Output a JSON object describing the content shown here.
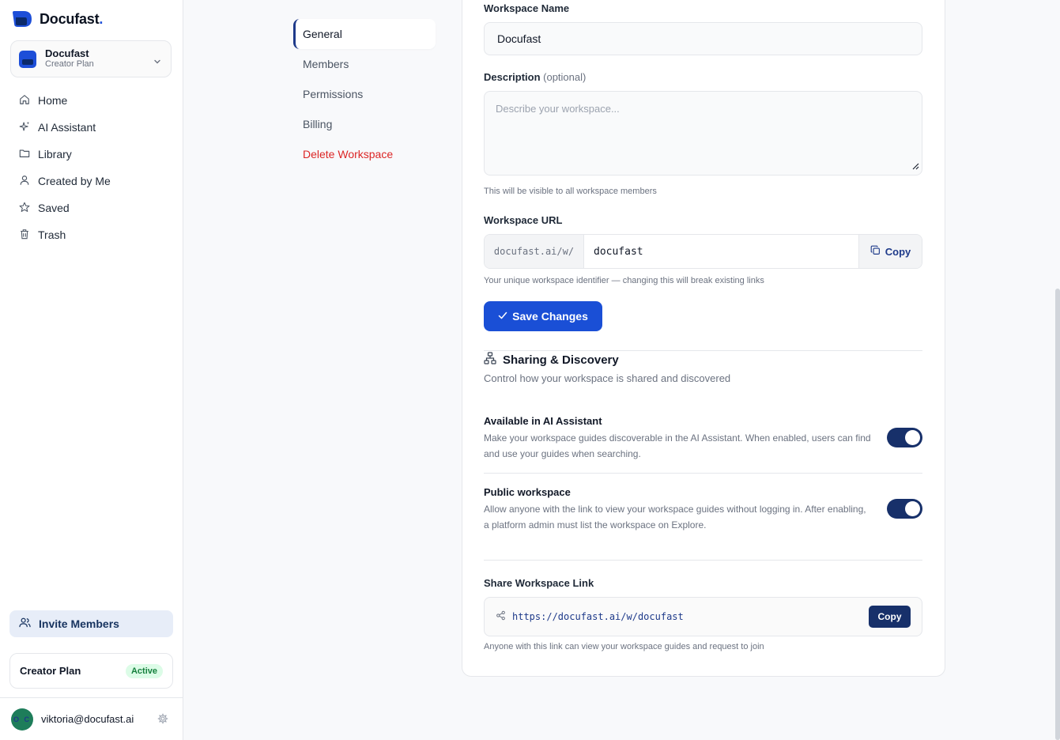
{
  "brand": {
    "name": "Docufast",
    "dot": "."
  },
  "workspace_switcher": {
    "name": "Docufast",
    "plan": "Creator Plan"
  },
  "nav": [
    {
      "label": "Home",
      "icon": "home-icon"
    },
    {
      "label": "AI Assistant",
      "icon": "sparkles-icon"
    },
    {
      "label": "Library",
      "icon": "folder-icon"
    },
    {
      "label": "Created by Me",
      "icon": "user-icon"
    },
    {
      "label": "Saved",
      "icon": "star-icon"
    },
    {
      "label": "Trash",
      "icon": "trash-icon"
    }
  ],
  "invite": {
    "label": "Invite Members"
  },
  "plan_box": {
    "title": "Creator Plan",
    "badge": "Active"
  },
  "user": {
    "initials": "O C",
    "email": "viktoria@docufast.ai"
  },
  "subnav": {
    "general": "General",
    "members": "Members",
    "permissions": "Permissions",
    "billing": "Billing",
    "delete": "Delete Workspace"
  },
  "form": {
    "name_label": "Workspace Name",
    "name_value": "Docufast",
    "desc_label": "Description",
    "desc_optional": "(optional)",
    "desc_placeholder": "Describe your workspace...",
    "desc_help": "This will be visible to all workspace members",
    "url_label": "Workspace URL",
    "url_prefix": "docufast.ai/w/",
    "url_value": "docufast",
    "url_copy": "Copy",
    "url_help": "Your unique workspace identifier — changing this will break existing links",
    "save_label": "Save Changes"
  },
  "sharing": {
    "title": "Sharing & Discovery",
    "subtitle": "Control how your workspace is shared and discovered",
    "ai_title": "Available in AI Assistant",
    "ai_desc": "Make your workspace guides discoverable in the AI Assistant. When enabled, users can find and use your guides when searching.",
    "ai_enabled": true,
    "public_title": "Public workspace",
    "public_desc": "Allow anyone with the link to view your workspace guides without logging in. After enabling, a platform admin must list the workspace on Explore.",
    "public_enabled": true,
    "share_label": "Share Workspace Link",
    "share_link": "https://docufast.ai/w/docufast",
    "share_copy": "Copy",
    "share_help": "Anyone with this link can view your workspace guides and request to join"
  },
  "colors": {
    "primary": "#1a4fd6",
    "navy": "#17306a",
    "danger": "#dc2626",
    "success": "#15803d"
  }
}
